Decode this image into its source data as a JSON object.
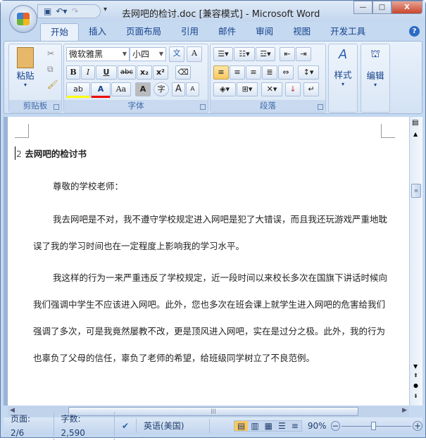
{
  "window": {
    "title": "去网吧的检讨.doc [兼容模式] - Microsoft Word",
    "minimize": "—",
    "maximize": "□",
    "close": "X"
  },
  "tabs": [
    "开始",
    "插入",
    "页面布局",
    "引用",
    "邮件",
    "审阅",
    "视图",
    "开发工具"
  ],
  "help": "?",
  "ribbon": {
    "clipboard": {
      "label": "剪贴板",
      "paste": "粘贴"
    },
    "font": {
      "label": "字体",
      "font_name": "微软雅黑",
      "font_size": "小四",
      "bold": "B",
      "italic": "I",
      "underline": "U",
      "strike": "abc",
      "sub": "x₂",
      "sup": "x²",
      "color": "A",
      "case": "Aa",
      "shade": "A",
      "circle": "字",
      "grow": "A",
      "shrink": "A",
      "phonetic": "文",
      "border": "A",
      "highlight": "ab"
    },
    "paragraph": {
      "label": "段落"
    },
    "styles": {
      "label": "样式"
    },
    "editing": {
      "label": "编辑"
    }
  },
  "document": {
    "heading_num": "2",
    "heading": "去网吧的检讨书",
    "paragraphs": [
      "尊敬的学校老师：",
      "我去网吧是不对，我不遵守学校规定进入网吧是犯了大错误，而且我还玩游戏严重地耽误了我的学习时间也在一定程度上影响我的学习水平。",
      "我这样的行为一来严重违反了学校规定，近一段时间以来校长多次在国旗下讲话时候向我们强调中学生不应该进入网吧。此外，您也多次在班会课上就学生进入网吧的危害给我们强调了多次，可是我竟然屡教不改，更是顶风进入网吧，实在是过分之极。此外，我的行为也辜负了父母的信任，辜负了老师的希望，给班级同学树立了不良范例。"
    ]
  },
  "status": {
    "page": "页面: 2/6",
    "words": "字数: 2,590",
    "language": "英语(美国)",
    "zoom": "90%",
    "zoom_percent": 90
  }
}
